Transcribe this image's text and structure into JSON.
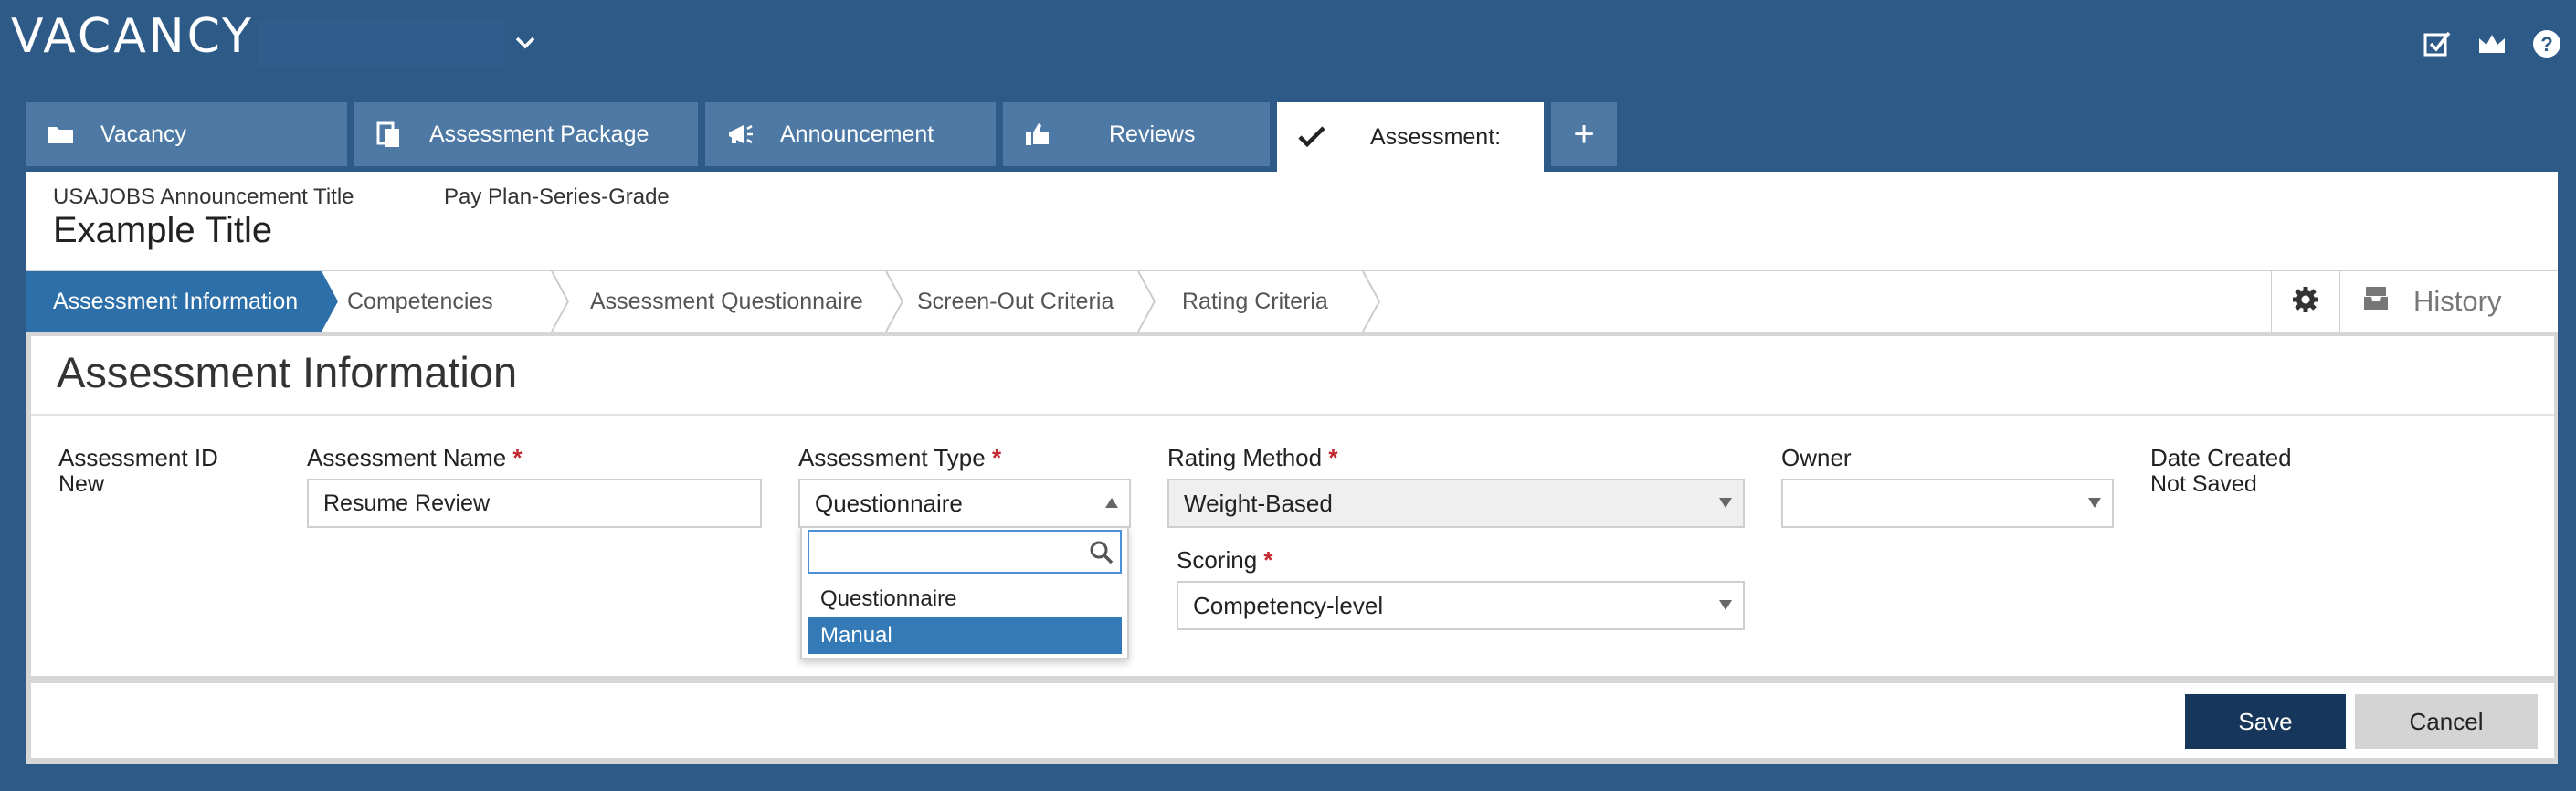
{
  "app": {
    "title": "VACANCY",
    "top_icons": [
      "checkbox-icon",
      "crown-icon",
      "help-icon"
    ]
  },
  "tabs": [
    {
      "label": "Vacancy",
      "icon": "folder-icon"
    },
    {
      "label": "Assessment Package",
      "icon": "documents-icon"
    },
    {
      "label": "Announcement",
      "icon": "megaphone-icon"
    },
    {
      "label": "Reviews",
      "icon": "thumbs-up-icon"
    },
    {
      "label": "Assessment:",
      "icon": "checkmark-icon",
      "active": true
    },
    {
      "label": "+",
      "icon": "plus-icon"
    }
  ],
  "header": {
    "announcement_label": "USAJOBS Announcement Title",
    "pay_label": "Pay Plan-Series-Grade",
    "title": "Example Title"
  },
  "steps": [
    {
      "label": "Assessment Information",
      "active": true
    },
    {
      "label": "Competencies"
    },
    {
      "label": "Assessment Questionnaire"
    },
    {
      "label": "Screen-Out Criteria"
    },
    {
      "label": "Rating Criteria"
    }
  ],
  "tools": {
    "history_label": "History"
  },
  "form": {
    "section_title": "Assessment Information",
    "assessment_id": {
      "label": "Assessment ID",
      "value": "New"
    },
    "assessment_name": {
      "label": "Assessment Name",
      "required": "*",
      "value": "Resume Review"
    },
    "assessment_type": {
      "label": "Assessment Type",
      "required": "*",
      "value": "Questionnaire"
    },
    "rating_method": {
      "label": "Rating Method",
      "required": "*",
      "value": "Weight-Based"
    },
    "owner": {
      "label": "Owner",
      "value": ""
    },
    "date_created": {
      "label": "Date Created",
      "value": "Not Saved"
    },
    "scoring": {
      "label": "Scoring",
      "required": "*",
      "value": "Competency-level"
    }
  },
  "dropdown": {
    "search_value": "",
    "options": [
      {
        "label": "Questionnaire",
        "selected": false
      },
      {
        "label": "Manual",
        "selected": true
      }
    ]
  },
  "footer": {
    "save_label": "Save",
    "cancel_label": "Cancel"
  },
  "colors": {
    "background": "#2d5a87",
    "tab": "#4d79a4",
    "step_active": "#2d6fa8",
    "save_button": "#16365c",
    "required": "#c1272d",
    "dropdown_selected": "#337ab7"
  }
}
